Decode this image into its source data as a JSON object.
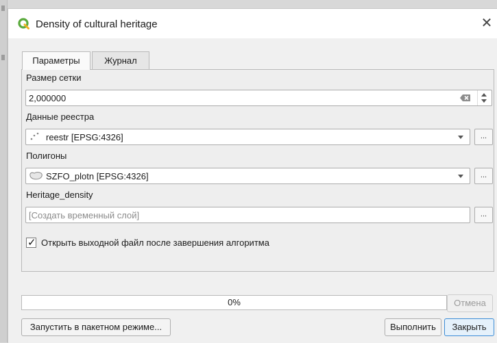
{
  "window": {
    "title": "Density of cultural heritage",
    "close_symbol": "✕"
  },
  "tabs": [
    {
      "label": "Параметры",
      "active": true
    },
    {
      "label": "Журнал",
      "active": false
    }
  ],
  "params": {
    "grid_size": {
      "label": "Размер сетки",
      "value": "2,000000"
    },
    "registry": {
      "label": "Данные реестра",
      "value": "reestr [EPSG:4326]",
      "icon": "point-layer-icon"
    },
    "polygons": {
      "label": "Полигоны",
      "value": "SZFO_plotn [EPSG:4326]",
      "icon": "polygon-layer-icon"
    },
    "output": {
      "label": "Heritage_density",
      "placeholder": "[Создать временный слой]"
    },
    "open_after": {
      "label": "Открыть выходной файл после завершения алгоритма",
      "checked": true
    },
    "ellipsis": "..."
  },
  "progress": {
    "text": "0%",
    "value": 0
  },
  "buttons": {
    "cancel": "Отмена",
    "batch": "Запустить в пакетном режиме...",
    "run": "Выполнить",
    "close": "Закрыть"
  },
  "colors": {
    "accent": "#3c8cd6",
    "qgis_green": "#5aaa3c"
  }
}
